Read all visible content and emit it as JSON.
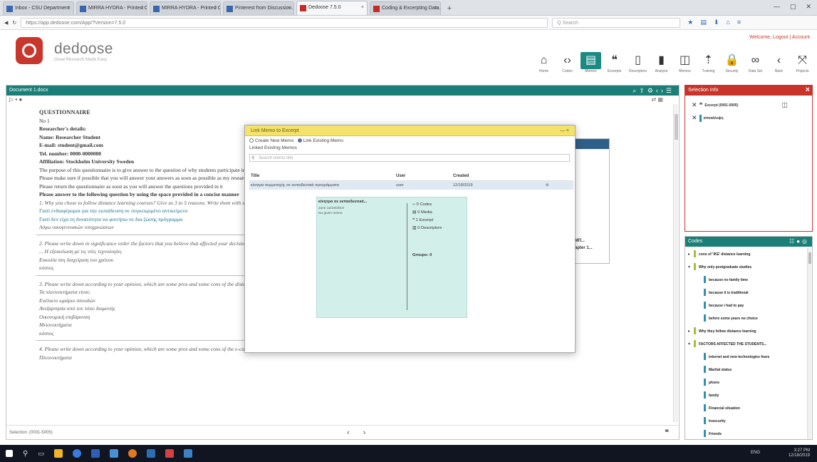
{
  "browser": {
    "tabs": [
      {
        "label": "Inbox - CSU Department"
      },
      {
        "label": "MIRRA HYDRA - Printed C..."
      },
      {
        "label": "MIRRA HYDRA - Printed C..."
      },
      {
        "label": "Pinterest from Discussion..."
      },
      {
        "label": "Dedoose 7.5.0"
      },
      {
        "label": "Coding & Excerpting Data..."
      }
    ],
    "url": "https://app.dedoose.com/App/?Version=7.5.0",
    "search_placeholder": "Q Search"
  },
  "app": {
    "brand": "dedoose",
    "tagline": "Great Research Made Easy",
    "userbar_prefix": "Welcome, ",
    "userbar_links": "Logout | Account"
  },
  "toolbar": [
    {
      "label": "Home",
      "icon": "home-icon",
      "glyph": "⌂"
    },
    {
      "label": "Codes",
      "icon": "code-brackets-icon",
      "glyph": "‹›"
    },
    {
      "label": "Memos",
      "icon": "memo-icon",
      "glyph": "▤"
    },
    {
      "label": "Excerpts",
      "icon": "quote-icon",
      "glyph": "❝"
    },
    {
      "label": "Descriptors",
      "icon": "document-icon",
      "glyph": "▯"
    },
    {
      "label": "Analyze",
      "icon": "bar-chart-icon",
      "glyph": "▮"
    },
    {
      "label": "Memos",
      "icon": "clipboard-icon",
      "glyph": "◫"
    },
    {
      "label": "Training",
      "icon": "upload-icon",
      "glyph": "⇡"
    },
    {
      "label": "Security",
      "icon": "lock-icon",
      "glyph": "🔒"
    },
    {
      "label": "Data Set",
      "icon": "glasses-icon",
      "glyph": "∞"
    },
    {
      "label": "Back",
      "icon": "back-icon",
      "glyph": "‹"
    },
    {
      "label": "Projects",
      "icon": "projects-icon",
      "glyph": "⤧"
    }
  ],
  "document": {
    "header": "Document 1.docx",
    "title": "QUESTIONNAIRE",
    "lines": [
      {
        "text": "No 1",
        "style": ""
      },
      {
        "text": "Researcher's details:",
        "style": "b"
      },
      {
        "text": "Name: Researcher Student",
        "style": "b"
      },
      {
        "text": "E-mail: student@gmail.com",
        "style": "b"
      },
      {
        "text": "Tel. number: 0000-0000000",
        "style": "b"
      },
      {
        "text": "Affiliation: Stockholm University Sweden",
        "style": "b"
      },
      {
        "text": "The purpose of this questionnaire is to give answer to the question of why students participate in distance learning programmes",
        "style": ""
      },
      {
        "text": "Please make sure if possible that you will answer your answers as soon as possible as my research need to be finished",
        "style": ""
      },
      {
        "text": "Please return the questionnaire as soon as you will answer the questions provided in it",
        "style": ""
      },
      {
        "text": "Please answer to the following question by using the space provided in a concise manner",
        "style": "b"
      },
      {
        "text": "1. Why you chose to follow distance learning courses? Give us 3 to 5 reasons. Write them with significance order.",
        "style": "it"
      },
      {
        "text": "Γιατί ενδιαφέρομαι για την εκπαίδευση σε συγκεκριμένο αντικείμενο",
        "style": "hl"
      },
      {
        "text": "Γιατί δεν είχα τη δυνατότητα να φοιτήσω σε δια ζώσης πρόγραμμα",
        "style": "hl"
      },
      {
        "text": "Λόγω οικογενειακών υποχρεώσεων",
        "style": "it"
      }
    ],
    "q2": "2. Please write down in significance order the factors that you believe that affected your decision.",
    "q2_lines": [
      "... Η εξοικείωση με τις νέες τεχνολογίες",
      "Ευκολία στη διαχείριση του χρόνου",
      "κόστος"
    ],
    "q3": "3. Please write down according to your opinion, which are some pros and some cons of the distance learning",
    "q3_lines": [
      "Τα πλεονεκτήματα είναι:",
      "Ευέλικτο ωράριο σπουδών",
      "Ανεξαρτησία από τον τόπο διαμονής",
      "Οικονομική επιβάρυνση",
      "Μειονεκτήματα",
      "κόστος"
    ],
    "q4": "4. Please write down according to your opinion, which are some pros and some cons of the e-campus educational method",
    "q4_lines": [
      "Πλεονεκτήματα"
    ],
    "status": "Selection: (0001-5005)",
    "nav": "‹ ›"
  },
  "modal": {
    "title": "Link Memo to Excerpt",
    "close": "— ×",
    "opt_create": "Create New Memo",
    "opt_link": "Link Existing Memo",
    "section": "Linked Existing Memos",
    "search_placeholder": "Search memo title",
    "columns": [
      "Title",
      "User",
      "Created"
    ],
    "rows": [
      {
        "title": "κίνητρα συμμετοχής σε εκπαιδευτικά προγράμματα",
        "user": "user",
        "created": "12/18/2019",
        "action": "⊘"
      }
    ],
    "card": {
      "title": "κίνητρα σε εκπαιδευτικά...",
      "desc_lines": [
        "Jane 12/18/2019",
        "No given memo"
      ],
      "stats": [
        "0 Codes",
        "0 Media",
        "1 Excerpt",
        "0 Descriptors"
      ],
      "groups": "Groups: 0"
    }
  },
  "bgpanel": {
    "rows": [
      "ΣΥΜΠ...",
      "Chapter 1..."
    ]
  },
  "selection": {
    "title": "Selection Info",
    "rows": [
      {
        "label": "Excerpt (0001-5005)"
      },
      {
        "label": "αποκάλυψη"
      }
    ]
  },
  "codes": {
    "title": "Codes",
    "items": [
      {
        "label": "cons of 'IKE' distance learning",
        "toggle": "▸",
        "level": 0,
        "color": "#a3c237"
      },
      {
        "label": "Why only postgraduate studies",
        "toggle": "▾",
        "level": 0,
        "color": "#a3c237"
      },
      {
        "label": "because no family time",
        "toggle": "",
        "level": 1,
        "color": "#2e8fb5"
      },
      {
        "label": "because it is traditional",
        "toggle": "",
        "level": 1,
        "color": "#2e8fb5"
      },
      {
        "label": "because i had to pay",
        "toggle": "",
        "level": 1,
        "color": "#2e8fb5"
      },
      {
        "label": "before some years no choice",
        "toggle": "",
        "level": 1,
        "color": "#2e8fb5"
      },
      {
        "label": "Why they follow distance learning",
        "toggle": "▸",
        "level": 0,
        "color": "#a3c237"
      },
      {
        "label": "FACTORS AFFECTED THE STUDENTS...",
        "toggle": "▾",
        "level": 0,
        "color": "#a3c237"
      },
      {
        "label": "internet and new technologies fears",
        "toggle": "",
        "level": 1,
        "color": "#2e8fb5"
      },
      {
        "label": "Marital status",
        "toggle": "",
        "level": 1,
        "color": "#2e8fb5"
      },
      {
        "label": "phone",
        "toggle": "",
        "level": 1,
        "color": "#2e8fb5"
      },
      {
        "label": "family",
        "toggle": "",
        "level": 1,
        "color": "#2e8fb5"
      },
      {
        "label": "Financial situation",
        "toggle": "",
        "level": 1,
        "color": "#2e8fb5"
      },
      {
        "label": "Insecurity",
        "toggle": "",
        "level": 1,
        "color": "#2e8fb5"
      },
      {
        "label": "Friends",
        "toggle": "",
        "level": 1,
        "color": "#2e8fb5"
      }
    ]
  },
  "taskbar": {
    "time": "3:27 PM",
    "date": "12/18/2019",
    "lang": "ENG"
  },
  "colors": {
    "teal": "#1b7f78",
    "red": "#c8342a",
    "modal_header": "#f4e26a",
    "card": "#d3efea"
  }
}
